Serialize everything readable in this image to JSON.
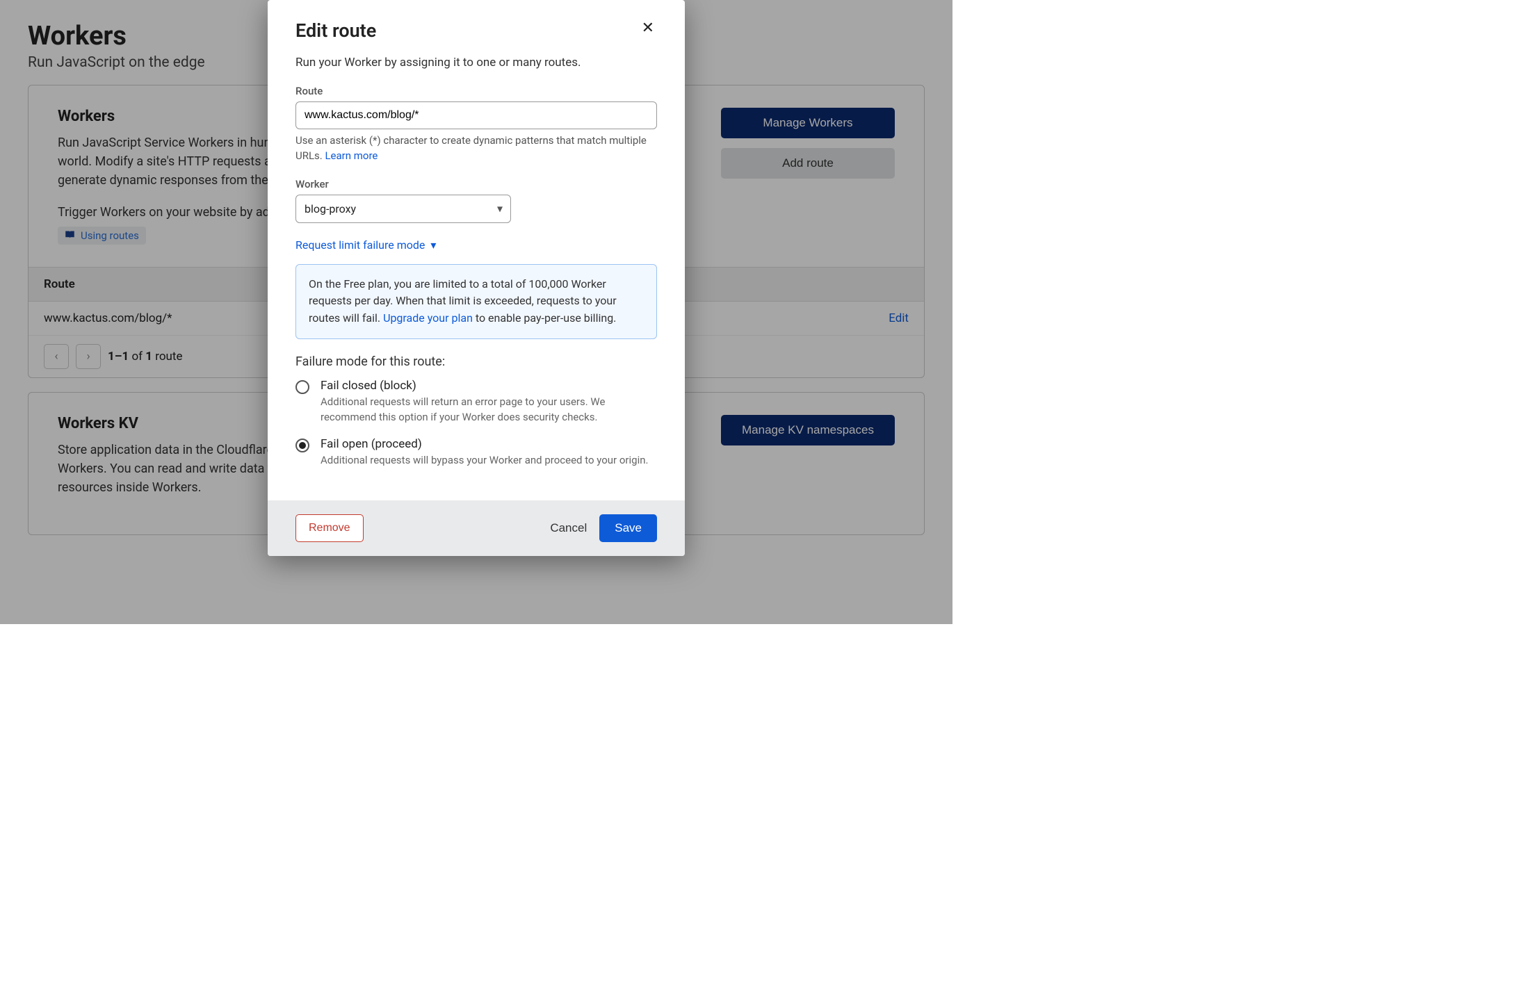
{
  "page": {
    "title": "Workers",
    "subtitle": "Run JavaScript on the edge"
  },
  "workers_card": {
    "title": "Workers",
    "desc": "Run JavaScript Service Workers in hundreds of Cloudflare data centers around the world. Modify a site's HTTP requests and responses, make parallel requests, or generate dynamic responses from the edge.",
    "trigger_text": "Trigger Workers on your website by adding a route below.",
    "tag_link": "Using routes",
    "manage_btn": "Manage Workers",
    "add_btn": "Add route"
  },
  "routes_table": {
    "header": "Route",
    "row_route": "www.kactus.com/blog/*",
    "edit": "Edit",
    "pager_text_a": "1–1",
    "pager_text_b": " of ",
    "pager_text_c": "1",
    "pager_text_d": " route"
  },
  "kv_card": {
    "title": "Workers KV",
    "desc": "Store application data in the Cloudflare network and access it from your Cloudflare Workers. You can read and write data to Workers KV Namespaces by binding them as resources inside Workers.",
    "manage_btn": "Manage KV namespaces"
  },
  "modal": {
    "title": "Edit route",
    "desc": "Run your Worker by assigning it to one or many routes.",
    "route_label": "Route",
    "route_value": "www.kactus.com/blog/*",
    "route_help_a": "Use an asterisk (*) character to create dynamic patterns that match multiple URLs. ",
    "route_help_link": "Learn more",
    "worker_label": "Worker",
    "worker_value": "blog-proxy",
    "disclosure": "Request limit failure mode",
    "info_a": "On the Free plan, you are limited to a total of 100,000 Worker requests per day. When that limit is exceeded, requests to your routes will fail. ",
    "info_link": "Upgrade your plan",
    "info_b": " to enable pay-per-use billing.",
    "failure_q": "Failure mode for this route:",
    "opt_closed_label": "Fail closed (block)",
    "opt_closed_help": "Additional requests will return an error page to your users. We recommend this option if your Worker does security checks.",
    "opt_open_label": "Fail open (proceed)",
    "opt_open_help": "Additional requests will bypass your Worker and proceed to your origin.",
    "remove": "Remove",
    "cancel": "Cancel",
    "save": "Save"
  }
}
